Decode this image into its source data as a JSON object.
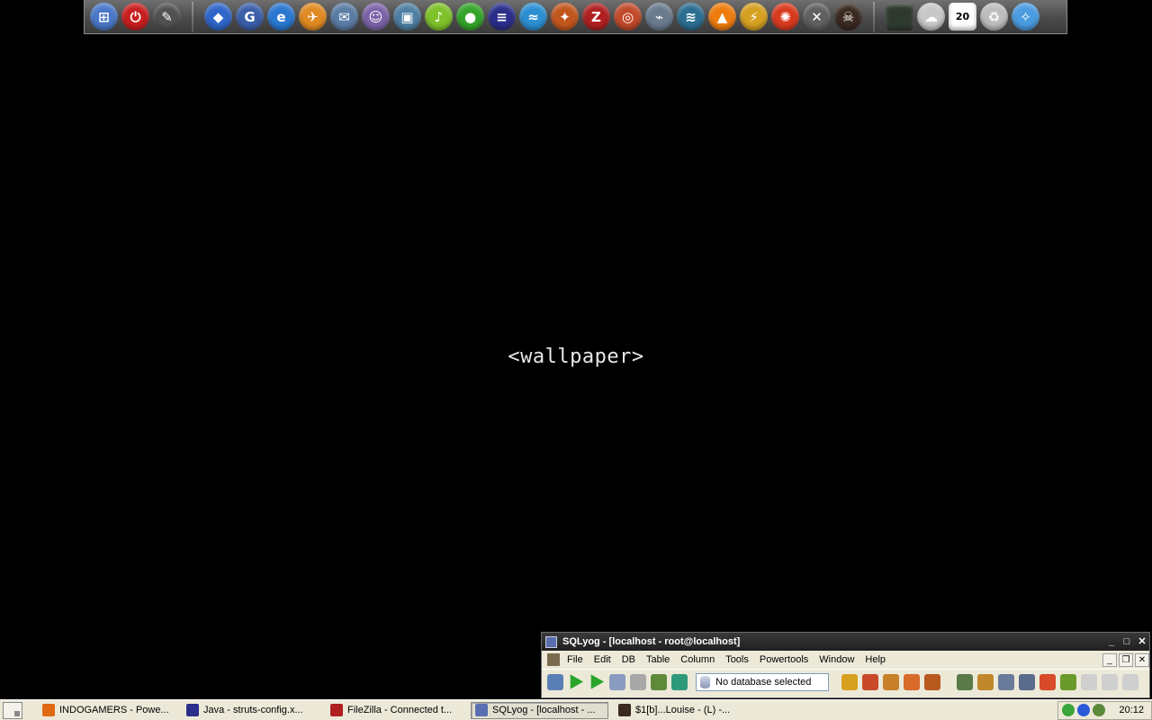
{
  "dock": {
    "icons": [
      {
        "name": "windows-flag-icon",
        "color": "#4a78c8",
        "glyph": "⊞"
      },
      {
        "name": "power-icon",
        "color": "#c81e1e",
        "glyph": "⏻"
      },
      {
        "name": "tux-icon",
        "color": "#505050",
        "glyph": "✎"
      },
      {
        "name": "box-icon",
        "color": "#2f66c9",
        "glyph": "◆"
      },
      {
        "name": "google-icon",
        "color": "#3b5fa8",
        "glyph": "G"
      },
      {
        "name": "internet-explorer-icon",
        "color": "#2a78d0",
        "glyph": "e"
      },
      {
        "name": "gadget-icon",
        "color": "#e08a22",
        "glyph": "✈"
      },
      {
        "name": "mail-icon",
        "color": "#5a7ca5",
        "glyph": "✉"
      },
      {
        "name": "pidgin-icon",
        "color": "#7c63a8",
        "glyph": "☺"
      },
      {
        "name": "photo-viewer-icon",
        "color": "#4f7fa3",
        "glyph": "▣"
      },
      {
        "name": "winamp-icon",
        "color": "#7fc22a",
        "glyph": "♪"
      },
      {
        "name": "green-orb-icon",
        "color": "#35a42a",
        "glyph": "●"
      },
      {
        "name": "eclipse-icon",
        "color": "#2b2e8a",
        "glyph": "≡"
      },
      {
        "name": "dolphin-icon",
        "color": "#2c8fd1",
        "glyph": "≈"
      },
      {
        "name": "fireworks-icon",
        "color": "#c2571e",
        "glyph": "✦"
      },
      {
        "name": "filezilla-icon",
        "color": "#b02020",
        "glyph": "Z"
      },
      {
        "name": "orbit-icon",
        "color": "#c14a2a",
        "glyph": "◎"
      },
      {
        "name": "network-icon",
        "color": "#6a7b8e",
        "glyph": "⌁"
      },
      {
        "name": "openoffice-icon",
        "color": "#2b6e91",
        "glyph": "≋"
      },
      {
        "name": "vlc-icon",
        "color": "#ef7d0e",
        "glyph": "▲"
      },
      {
        "name": "winrar-icon",
        "color": "#d6a020",
        "glyph": "⚡"
      },
      {
        "name": "firefox-icon",
        "color": "#d93a1e",
        "glyph": "✺"
      },
      {
        "name": "tools-icon",
        "color": "#606060",
        "glyph": "✕"
      },
      {
        "name": "game-icon",
        "color": "#3a2a20",
        "glyph": "☠"
      }
    ],
    "right_icons": [
      {
        "name": "monitor-icon",
        "color": "#2f3a2f",
        "glyph": ""
      },
      {
        "name": "weather-icon",
        "color": "#c8c8c8",
        "glyph": "☁"
      },
      {
        "name": "calendar-icon",
        "color": "#ffffff",
        "glyph": "20"
      },
      {
        "name": "recycle-bin-icon",
        "color": "#bdbdbd",
        "glyph": "♻"
      },
      {
        "name": "safari-icon",
        "color": "#4a9be0",
        "glyph": "✧"
      }
    ]
  },
  "wallpaper": {
    "text": "<wallpaper>"
  },
  "sqlyog": {
    "title": "SQLyog - [localhost - root@localhost]",
    "menu": [
      "File",
      "Edit",
      "DB",
      "Table",
      "Column",
      "Tools",
      "Powertools",
      "Window",
      "Help"
    ],
    "db_combo": "No database selected"
  },
  "taskbar": {
    "tasks": [
      {
        "label": "INDOGAMERS - Powe...",
        "icon_color": "#e06a12",
        "active": false
      },
      {
        "label": "Java - struts-config.x...",
        "icon_color": "#2b2e8a",
        "active": false
      },
      {
        "label": "FileZilla - Connected t...",
        "icon_color": "#b02020",
        "active": false
      },
      {
        "label": "SQLyog - [localhost - ...",
        "icon_color": "#5a6fb0",
        "active": true
      },
      {
        "label": "$1[b]...Louise - (L) -...",
        "icon_color": "#3a2a20",
        "active": false
      }
    ],
    "clock": "20:12"
  }
}
